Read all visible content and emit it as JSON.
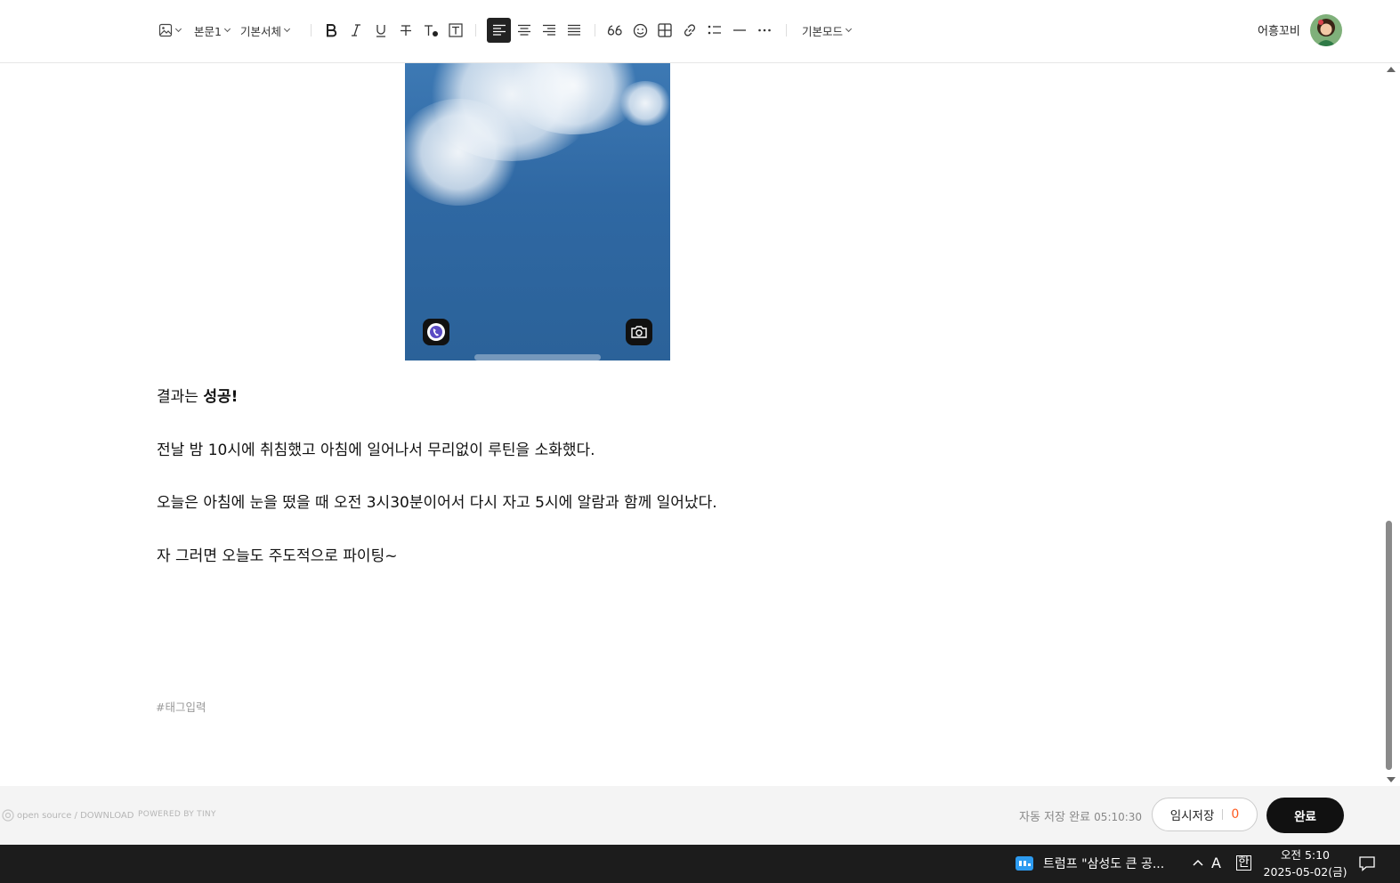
{
  "toolbar": {
    "paragraph_style": "본문1",
    "font_family": "기본서체",
    "mode": "기본모드",
    "user_name": "어흥꼬비"
  },
  "content": {
    "p1_prefix": "결과는 ",
    "p1_bold": "성공!",
    "p2": "전날 밤 10시에 취침했고 아침에 일어나서 무리없이 루틴을 소화했다.",
    "p3": "오늘은 아침에 눈을 떴을 때 오전 3시30분이어서 다시 자고 5시에 알람과 함께 일어났다.",
    "p4": "자 그러면 오늘도 주도적으로 파이팅~",
    "tag_placeholder": "#태그입력"
  },
  "footer": {
    "open_source": "open source / DOWNLOAD",
    "powered_by": "POWERED BY TINY",
    "autosave_text": "자동 저장 완료",
    "autosave_time": "05:10:30",
    "temp_save_label": "임시저장",
    "temp_save_count": "0",
    "done_label": "완료"
  },
  "taskbar": {
    "news_text": "트럼프 \"삼성도 큰 공...",
    "ime_mode": "A",
    "ime_lang": "한",
    "time": "오전 5:10",
    "date": "2025-05-02(금)"
  },
  "colors": {
    "accent_orange": "#ff5a1f",
    "done_button": "#111111",
    "sky": "#2f68a3"
  }
}
